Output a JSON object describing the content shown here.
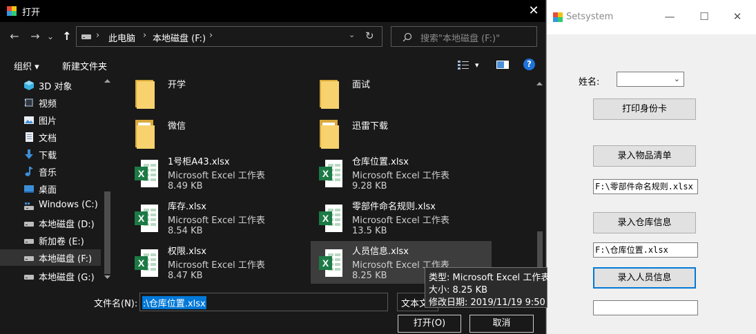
{
  "dialog": {
    "title": "打开",
    "close": "✕",
    "nav": {
      "back": "←",
      "forward": "→",
      "recent": "⌄",
      "up": "↑",
      "refresh": "↻",
      "dropdown": "⌄"
    },
    "breadcrumb": [
      "此电脑",
      "本地磁盘 (F:)"
    ],
    "search_placeholder": "搜索\"本地磁盘 (F:)\"",
    "toolbar": {
      "organize": "组织 ▾",
      "new_folder": "新建文件夹",
      "view_dropdown": "▾",
      "help": "?"
    },
    "sidebar": [
      {
        "label": "3D 对象",
        "icon": "3d-objects-icon"
      },
      {
        "label": "视频",
        "icon": "video-icon"
      },
      {
        "label": "图片",
        "icon": "pictures-icon"
      },
      {
        "label": "文档",
        "icon": "documents-icon"
      },
      {
        "label": "下载",
        "icon": "download-icon"
      },
      {
        "label": "音乐",
        "icon": "music-icon"
      },
      {
        "label": "桌面",
        "icon": "desktop-icon"
      },
      {
        "label": "Windows (C:)",
        "icon": "drive-icon"
      },
      {
        "label": "本地磁盘 (D:)",
        "icon": "drive-icon"
      },
      {
        "label": "新加卷 (E:)",
        "icon": "drive-icon"
      },
      {
        "label": "本地磁盘 (F:)",
        "icon": "drive-icon",
        "selected": true
      },
      {
        "label": "本地磁盘 (G:)",
        "icon": "drive-icon"
      }
    ],
    "files": [
      {
        "name": "开学",
        "kind": "folder"
      },
      {
        "name": "面试",
        "kind": "folder"
      },
      {
        "name": "微信",
        "kind": "folder"
      },
      {
        "name": "迅雷下载",
        "kind": "folder"
      },
      {
        "name": "1号柜A43.xlsx",
        "type": "Microsoft Excel 工作表",
        "size": "8.49 KB",
        "kind": "excel"
      },
      {
        "name": "仓库位置.xlsx",
        "type": "Microsoft Excel 工作表",
        "size": "9.28 KB",
        "kind": "excel"
      },
      {
        "name": "库存.xlsx",
        "type": "Microsoft Excel 工作表",
        "size": "8.54 KB",
        "kind": "excel"
      },
      {
        "name": "零部件命名规则.xlsx",
        "type": "Microsoft Excel 工作表",
        "size": "13.5 KB",
        "kind": "excel"
      },
      {
        "name": "权限.xlsx",
        "type": "Microsoft Excel 工作表",
        "size": "8.47 KB",
        "kind": "excel"
      },
      {
        "name": "人员信息.xlsx",
        "type": "Microsoft Excel 工作表",
        "size": "8.25 KB",
        "kind": "excel",
        "selected": true
      }
    ],
    "tooltip": {
      "type": "类型: Microsoft Excel 工作表",
      "size": "大小: 8.25 KB",
      "modified": "修改日期: 2019/11/19 9:50"
    },
    "filename_label": "文件名(N):",
    "filename_value": ":\\仓库位置.xlsx",
    "filetype_value": "文本文",
    "open_button": "打开(O)",
    "cancel_button": "取消",
    "colors": {
      "background": "#191919",
      "selection": "#0078d7"
    }
  },
  "app": {
    "title": "Setsystem",
    "controls": {
      "minimize": "—",
      "maximize": "☐",
      "close": "✕"
    },
    "name_label": "姓名:",
    "print_id_button": "打印身份卡",
    "import_items_button": "录入物品清单",
    "items_path": "F:\\零部件命名规则.xlsx",
    "import_warehouse_button": "录入仓库信息",
    "warehouse_path": "F:\\仓库位置.xlsx",
    "import_personnel_button": "录入人员信息",
    "personnel_path": ""
  }
}
